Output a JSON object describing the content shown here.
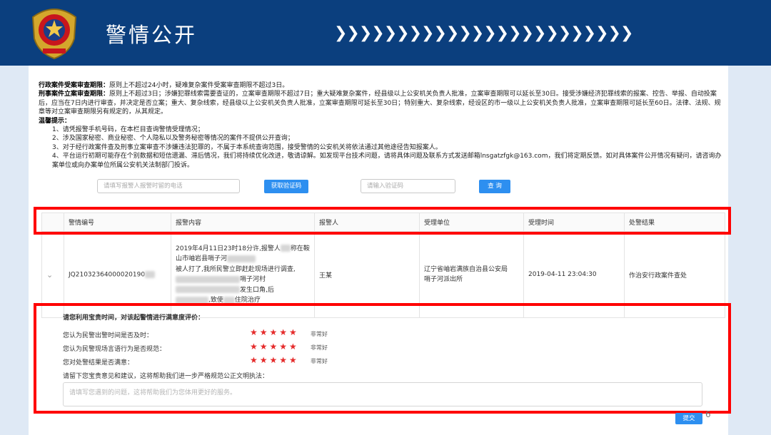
{
  "header": {
    "title": "警情公开",
    "chevrons": "❯❯❯❯❯❯❯❯❯❯❯❯❯❯❯❯❯❯❯❯❯❯❯❯"
  },
  "notice": {
    "line1_bold": "行政案件受案审查期限：",
    "line1": "原则上不超过24小时，疑难复杂案件受案审查期限不超过3日。",
    "line2_bold": "刑事案件立案审查期限：",
    "line2": "原则上不超过3日；涉嫌犯罪线索需要查证的，立案审查期限不超过7日；重大疑难复杂案件，经县级以上公安机关负责人批准，立案审查期限可以延长至30日。接受涉嫌经济犯罪线索的报案、控告、举报、自动投案后，应当在7日内进行审查，并决定是否立案；重大、复杂线索，经县级以上公安机关负责人批准，立案审查期限可延长至30日；特别重大、复杂线索，经设区的市一级以上公安机关负责人批准，立案审查期限可延长至60日。法律、法规、规章等对立案审查期限另有规定的，从其规定。",
    "tips_bold": "温馨提示：",
    "tip1": "1、请凭报警手机号码，在本栏目查询警情受理情况；",
    "tip2": "2、涉及国家秘密、商业秘密、个人隐私以及警务秘密等情况的案件不提供公开查询；",
    "tip3": "3、对于经行政案件查及刑事立案审查不涉嫌违法犯罪的，不属于本系统查询范围，接受警情的公安机关将依法通过其他途径告知报案人。",
    "tip4": "4、平台运行初期可能存在个别数据和短信遗漏、滞后情况，我们将持续优化改进，敬请谅解。如发现平台技术问题，请将具体问题及联系方式发送邮箱lnsgatzfgk@163.com，我们将定期反馈。如对具体案件公开情况有疑问，请咨询办案单位或向办案单位所属公安机关法制部门投诉。"
  },
  "search": {
    "phone_placeholder": "请填写报警人报警时留的电话",
    "get_code_label": "获取验证码",
    "code_placeholder": "请输入验证码",
    "query_label": "查 询"
  },
  "table": {
    "columns": [
      "警情编号",
      "报警内容",
      "报警人",
      "受理单位",
      "受理时间",
      "处警结果"
    ],
    "row": {
      "expand_icon": "⌄",
      "id": "JQ21032364000020190",
      "content_1": "2019年4月11日23时18分许,报警人",
      "content_1b": "称在鞍",
      "content_2": "山市岫岩县哨子河",
      "content_3": "被人打了,我所民警立即赶赴现场进行调查,",
      "content_4": "哨子河村",
      "content_5": "发生口角,后",
      "content_6": ",致使",
      "content_6b": "住院治疗",
      "reporter": "王某",
      "unit_1": "辽宁省岫岩满族自治县公安局",
      "unit_2": "哨子河派出所",
      "time": "2019-04-11 23:04:30",
      "result": "作治安行政案件查处"
    }
  },
  "evaluation": {
    "heading": "请您利用宝贵时间，对该起警情进行满意度评价：",
    "q1": "您认为民警出警时间是否及时：",
    "q2": "您认为民警现场言语行为是否规范：",
    "q3": "您对处警结果是否满意：",
    "stars": "★★★★★",
    "rating": 5,
    "rating_label": "非常好",
    "suggest_label": "请留下您宝贵意见和建议，这将帮助我们进一步严格规范公正文明执法：",
    "textarea_placeholder": "请填写您遇到的问题，这将帮助我们为您体用更好的服务。",
    "submit_label": "提交"
  },
  "page_number": "6",
  "colors": {
    "header_bg": "#0b3f7e",
    "button_blue": "#2d8ff0",
    "highlight_red": "#ff0000",
    "star_red": "#e52b2b"
  }
}
